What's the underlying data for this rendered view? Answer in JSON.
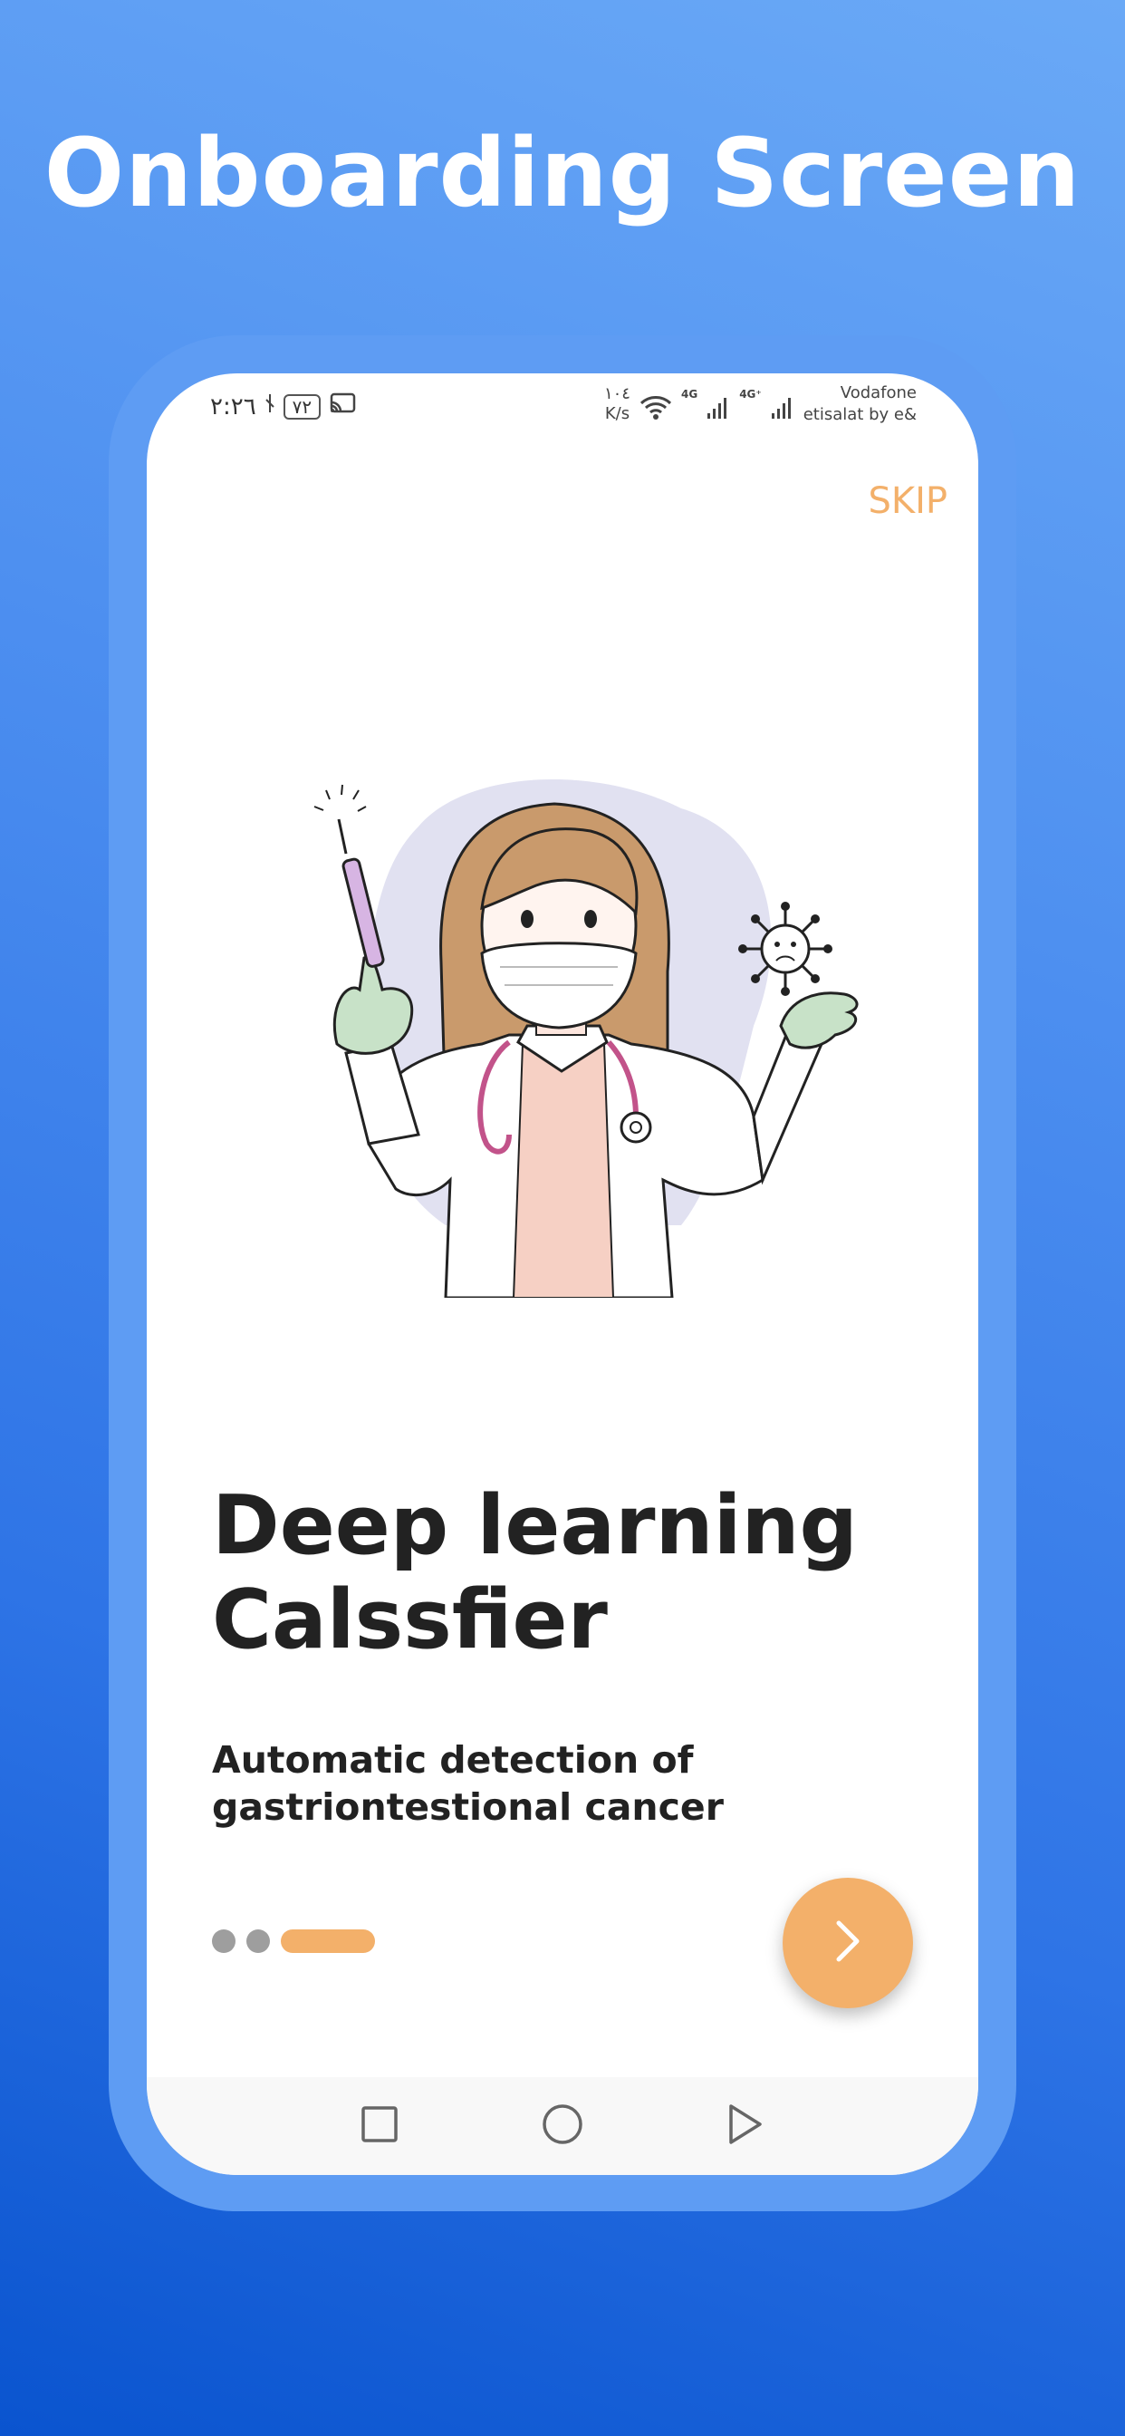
{
  "page": {
    "title": "Onboarding Screen"
  },
  "status_bar": {
    "time": "٢:٢٦",
    "battery": "٧٢",
    "speed_value": "١٠٤",
    "speed_unit": "K/s",
    "network_1": "4G",
    "network_2": "4G⁺",
    "carrier_1": "Vodafone",
    "carrier_2": "etisalat by e&"
  },
  "onboarding": {
    "skip_label": "SKIP",
    "headline_line1": "Deep learning",
    "headline_line2": "Calssfier",
    "subtitle_line1": "Automatic detection of",
    "subtitle_line2": "gastriontestional cancer",
    "page_count": 3,
    "active_page": 3
  },
  "colors": {
    "accent": "#f3b06a",
    "background_top": "#6aa9f6",
    "background_bottom": "#0a54cf",
    "frame": "#5e9cf3",
    "inactive_dot": "#9e9e9e"
  },
  "icons": [
    "signal-icon",
    "cast-icon",
    "wifi-icon",
    "cell-signal-icon",
    "chevron-right-icon",
    "nav-recents-icon",
    "nav-home-icon",
    "nav-back-icon"
  ]
}
